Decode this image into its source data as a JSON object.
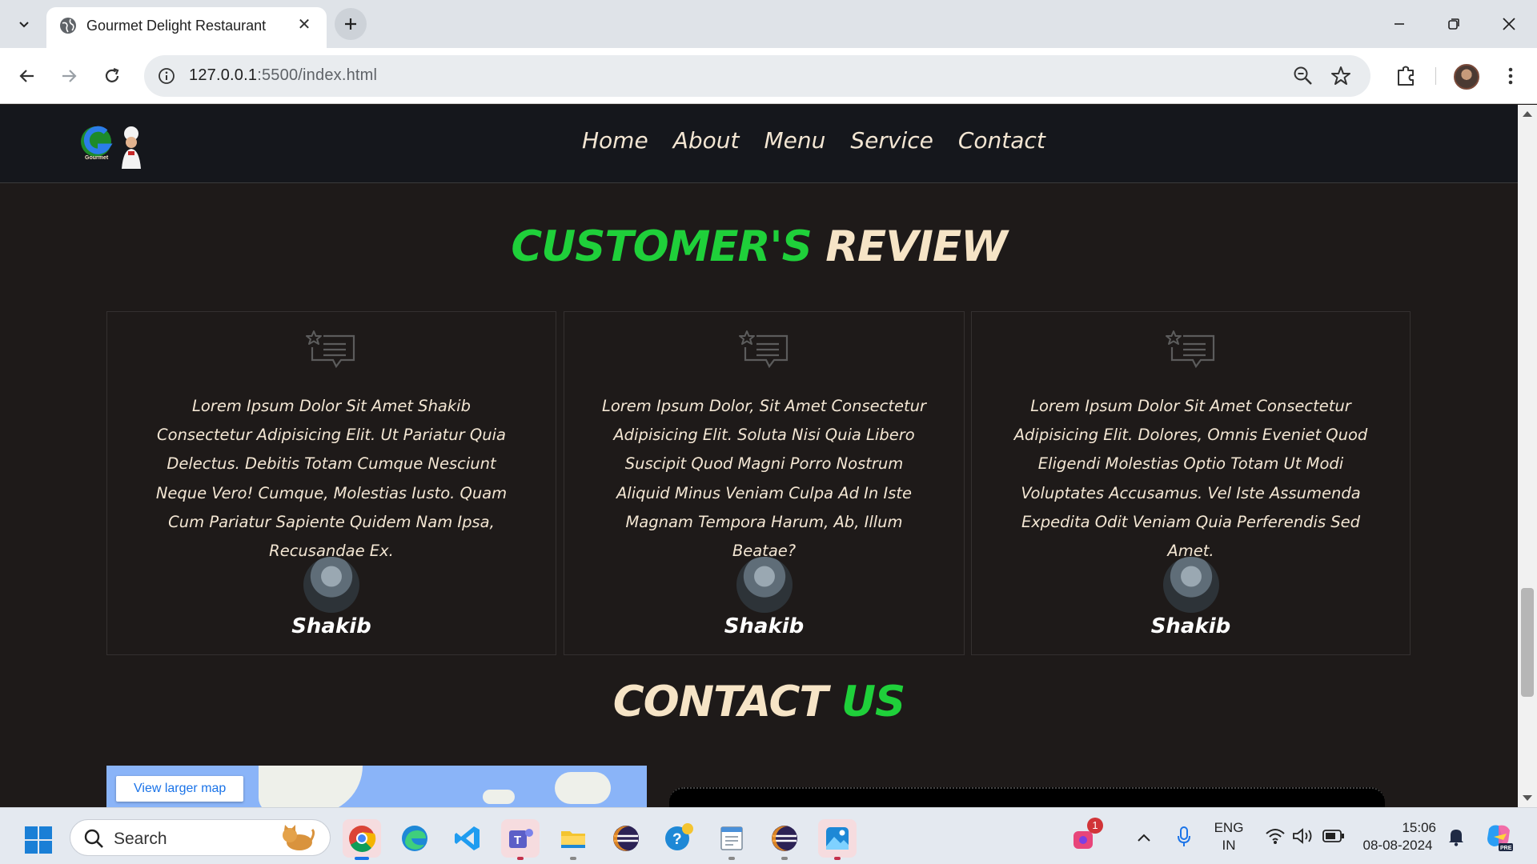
{
  "browser": {
    "tab_title": "Gourmet Delight Restaurant",
    "url_host": "127.0.0.1",
    "url_rest": ":5500/index.html"
  },
  "site": {
    "nav": [
      "Home",
      "About",
      "Menu",
      "Service",
      "Contact"
    ],
    "logo_text": "Gourmet"
  },
  "reviews": {
    "title_part1": "CUSTOMER'S",
    "title_part2": "REVIEW",
    "items": [
      {
        "text": "Lorem Ipsum Dolor Sit Amet Shakib Consectetur Adipisicing Elit. Ut Pariatur Quia Delectus. Debitis Totam Cumque Nesciunt Neque Vero! Cumque, Molestias Iusto. Quam Cum Pariatur Sapiente Quidem Nam Ipsa, Recusandae Ex.",
        "name": "Shakib"
      },
      {
        "text": "Lorem Ipsum Dolor, Sit Amet Consectetur Adipisicing Elit. Soluta Nisi Quia Libero Suscipit Quod Magni Porro Nostrum Aliquid Minus Veniam Culpa Ad In Iste Magnam Tempora Harum, Ab, Illum Beatae?",
        "name": "Shakib"
      },
      {
        "text": "Lorem Ipsum Dolor Sit Amet Consectetur Adipisicing Elit. Dolores, Omnis Eveniet Quod Eligendi Molestias Optio Totam Ut Modi Voluptates Accusamus. Vel Iste Assumenda Expedita Odit Veniam Quia Perferendis Sed Amet.",
        "name": "Shakib"
      }
    ]
  },
  "contact": {
    "title_part1": "CONTACT",
    "title_part2": "US",
    "map_button": "View larger map"
  },
  "taskbar": {
    "search_label": "Search",
    "lang_line1": "ENG",
    "lang_line2": "IN",
    "time": "15:06",
    "date": "08-08-2024",
    "notif_badge": "1"
  },
  "colors": {
    "accent_green": "#1fd03a",
    "cream": "#f6e4c6",
    "page_bg": "#1e1a19",
    "header_bg": "#15171c"
  }
}
